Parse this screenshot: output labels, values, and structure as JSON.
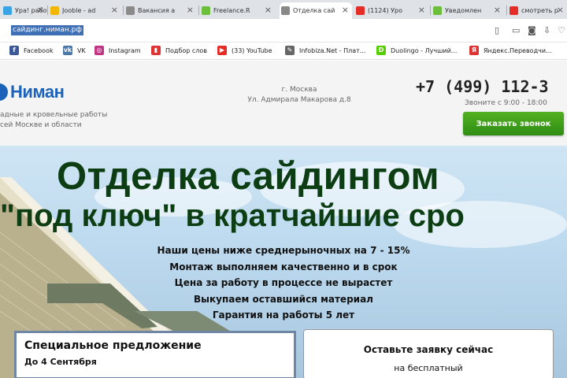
{
  "browser": {
    "tabs": [
      {
        "label": "Ура! работ",
        "color": "#3aa3e3"
      },
      {
        "label": "Jooble - ad",
        "color": "#f2b705"
      },
      {
        "label": "Вакансия а",
        "color": "#8a8a8a"
      },
      {
        "label": "Freelance.R",
        "color": "#6cbf3b"
      },
      {
        "label": "Отделка сай",
        "color": "#888888",
        "active": true
      },
      {
        "label": "(1124) Уро",
        "color": "#e52d27"
      },
      {
        "label": "Уведомлен",
        "color": "#6cbf3b"
      },
      {
        "label": "смотреть р",
        "color": "#e52d27"
      }
    ],
    "url": "сайдинг.ниман.рф",
    "bookmarks": [
      {
        "label": "Facebook",
        "color": "#3b5998",
        "glyph": "f"
      },
      {
        "label": "VK",
        "color": "#4a76a8",
        "glyph": "vk"
      },
      {
        "label": "Instagram",
        "color": "#c13584",
        "glyph": "◎"
      },
      {
        "label": "Подбор слов",
        "color": "#d33",
        "glyph": "▮"
      },
      {
        "label": "(33) YouTube",
        "color": "#e52d27",
        "glyph": "▶"
      },
      {
        "label": "Infobiza.Net - Плат...",
        "color": "#666",
        "glyph": "✎"
      },
      {
        "label": "Duolingo - Лучший...",
        "color": "#58cc02",
        "glyph": "D"
      },
      {
        "label": "Яндекс.Переводчи...",
        "color": "#d33",
        "glyph": "Я"
      }
    ]
  },
  "header": {
    "logo": "Ниман",
    "tagline": "адные и кровельные работы сей Москве и области",
    "city": "г. Москва",
    "street": "Ул. Адмирала Макарова д.8",
    "phone": "+7 (499) 112-3",
    "hours": "Звоните с 9:00 - 18:00",
    "call_button": "Заказать звонок"
  },
  "hero": {
    "title_line1": "Отделка сайдингом",
    "title_line2": "\"под ключ\" в кратчайшие сро",
    "benefits": [
      "Наши цены ниже среднерыночных на 7 - 15%",
      "Монтаж выполняем качественно и в срок",
      "Цена за работу в процессе не вырастет",
      "Выкупаем оставшийся материал",
      "Гарантия на работы 5 лет"
    ],
    "offer_title": "Специальное предложение",
    "offer_date": "До 4 Сентября",
    "lead_title": "Оставьте заявку сейчас",
    "lead_sub": "на бесплатный"
  }
}
